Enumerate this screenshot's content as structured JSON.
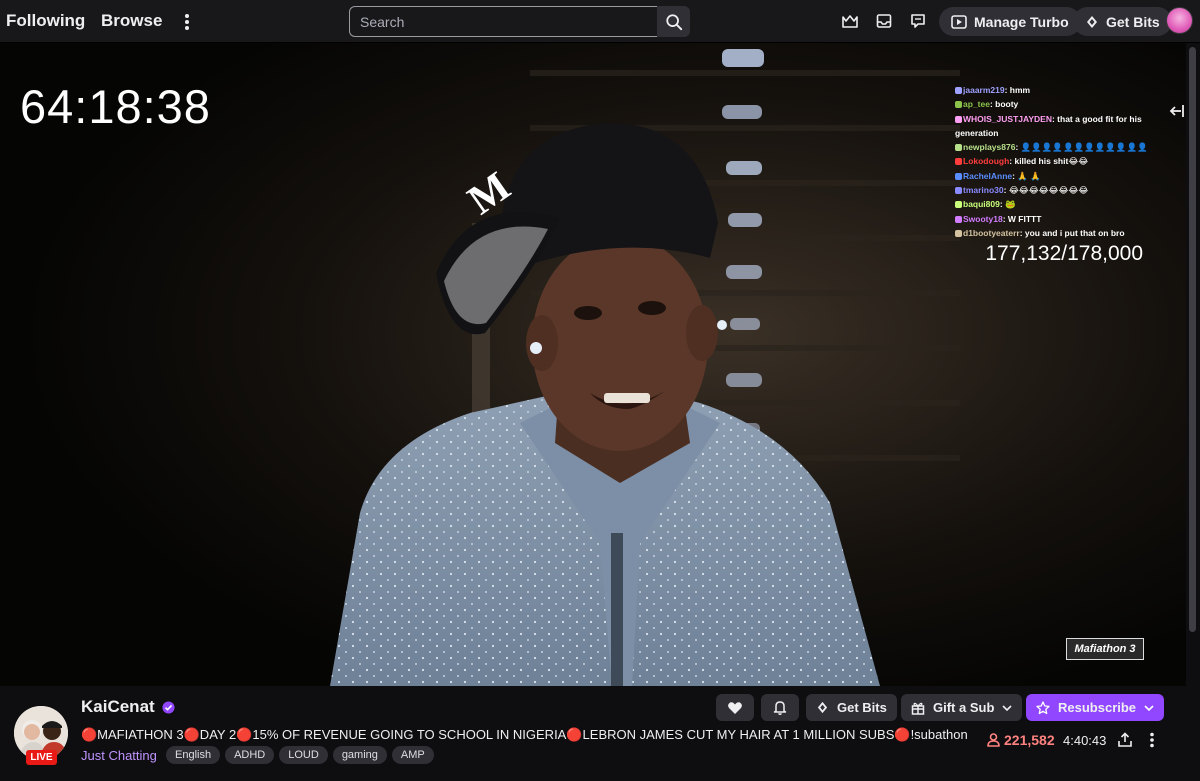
{
  "nav": {
    "following": "Following",
    "browse": "Browse",
    "search_placeholder": "Search",
    "manage_turbo": "Manage Turbo",
    "get_bits": "Get Bits"
  },
  "player": {
    "timer": "64:18:38",
    "sub_count": "177,132/178,000",
    "watermark": "Mafiathon 3"
  },
  "chat": [
    {
      "user": "jaaarm219",
      "text": "hmm",
      "color": "#9ea1ff"
    },
    {
      "user": "ap_tee",
      "text": "booty",
      "color": "#8bc34a"
    },
    {
      "user": "WHOIS_JUSTJAYDEN",
      "text": "that a good fit for his generation",
      "color": "#ff9ff3"
    },
    {
      "user": "newplays876",
      "text": "👤👤👤👤👤👤👤👤👤👤👤👤",
      "color": "#b6e08a"
    },
    {
      "user": "Lokodough",
      "text": "killed his shit😂😂",
      "color": "#ff3d3d"
    },
    {
      "user": "RachelAnne",
      "text": "🙏 🙏",
      "color": "#5a8dff"
    },
    {
      "user": "tmarino30",
      "text": "😂😂😂😂😂😂😂😂",
      "color": "#8a8aff"
    },
    {
      "user": "baqui809",
      "text": "🐸",
      "color": "#c9ff7a"
    },
    {
      "user": "Swooty18",
      "text": "W FITTT",
      "color": "#d27cff"
    },
    {
      "user": "d1bootyeaterr",
      "text": "you and i put that on bro",
      "color": "#d4c2a0"
    }
  ],
  "channel": {
    "name": "KaiCenat",
    "live": "LIVE",
    "title": "🔴MAFIATHON 3🔴DAY 2🔴15% OF REVENUE GOING TO SCHOOL IN NIGERIA🔴LEBRON JAMES CUT MY HAIR AT 1 MILLION SUBS🔴!subathon",
    "category": "Just Chatting",
    "tags": [
      "English",
      "ADHD",
      "LOUD",
      "gaming",
      "AMP"
    ],
    "viewers": "221,582",
    "uptime": "4:40:43"
  },
  "actions": {
    "get_bits": "Get Bits",
    "gift_sub": "Gift a Sub",
    "resubscribe": "Resubscribe"
  },
  "colors": {
    "twitch_purple": "#9147ff",
    "live_red": "#e91916",
    "viewer_red": "#ff8280",
    "category_purple": "#bf94ff"
  }
}
